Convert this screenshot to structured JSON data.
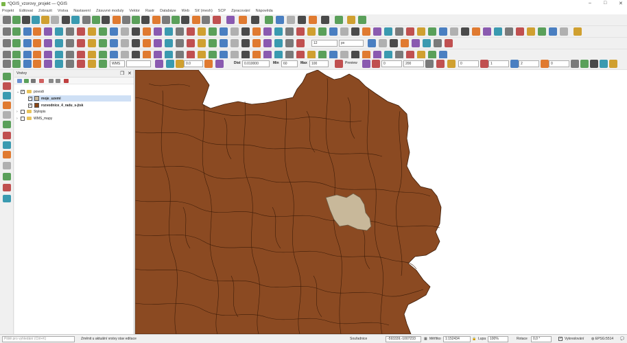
{
  "window": {
    "title": "*QGIS_vzorovy_projekt — QGIS"
  },
  "menu": [
    "Projekt",
    "Editovat",
    "Zobrazit",
    "Vrstva",
    "Nastavení",
    "Zásuvné moduly",
    "Vektor",
    "Rastr",
    "Databáze",
    "Web",
    "Síť (mesh)",
    "SCP",
    "Zpracování",
    "Nápověda"
  ],
  "toolbar": {
    "font_size_value": "12",
    "font_unit": "px",
    "wms_label": "WMS",
    "opacity_value": "0.0",
    "dist_label": "Dist",
    "dist_value": "0.010000",
    "min_label": "Min",
    "min_value": "60",
    "max_label": "Max",
    "max_value": "100",
    "preview_label": "Preview",
    "field_0": "0",
    "field_200": "200",
    "field_0b": "0",
    "field_1": "1",
    "field_2": "2",
    "field_0c": "0"
  },
  "layers_panel": {
    "title": "Vrstvy",
    "items": [
      {
        "label": "povodi",
        "checked": true,
        "kind": "group",
        "expanded": true
      },
      {
        "label": "moje_uzemi",
        "checked": true,
        "kind": "layer",
        "selected": true,
        "color": "#c8b89a"
      },
      {
        "label": "rozvodnice_4_radu_s-jtsk",
        "checked": true,
        "kind": "layer",
        "color": "#8b4513"
      },
      {
        "label": "Stylopis",
        "checked": false,
        "kind": "group",
        "expanded": false
      },
      {
        "label": "WMS_mapy",
        "checked": false,
        "kind": "group",
        "expanded": false
      }
    ]
  },
  "map": {
    "fill_color": "#8b4a22",
    "highlight_color": "#c8b89a",
    "stroke_color": "#3d1c08"
  },
  "statusbar": {
    "search_placeholder": "Piště pro vyhledání (Ctrl+K)",
    "message": "Změnit u aktuální vrstvy stav editace",
    "coords_label": "Souřadnice",
    "coords_value": "-593339,-1007233",
    "scale_label": "Měřítko",
    "scale_value": "1:152434",
    "magnifier_label": "Lupa",
    "magnifier_value": "100%",
    "rotation_label": "Rotace",
    "rotation_value": "0,0 °",
    "render_label": "Vykreslování",
    "crs_label": "EPSG:5514"
  }
}
